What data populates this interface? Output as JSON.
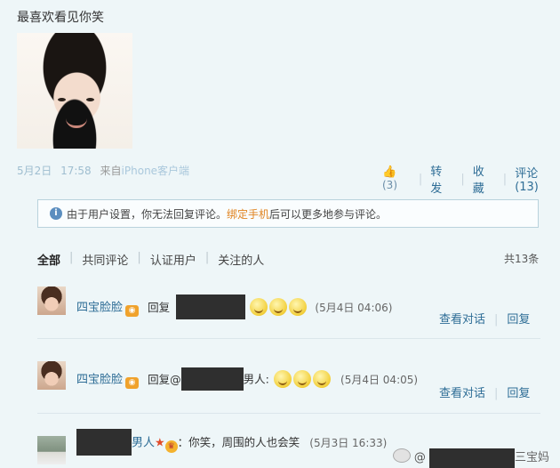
{
  "post": {
    "text": "最喜欢看见你笑",
    "date": "5月2日",
    "time": "17:58",
    "source_prefix": "来自",
    "source": "iPhone客户端"
  },
  "actions": {
    "like_count": "(3)",
    "repost": "转发",
    "favorite": "收藏",
    "comment": "评论(13)"
  },
  "notice": {
    "text_before": "由于用户设置，你无法回复评论。",
    "link": "绑定手机",
    "text_after": "后可以更多地参与评论。"
  },
  "filters": {
    "items": [
      "全部",
      "共同评论",
      "认证用户",
      "关注的人"
    ],
    "total": "共13条"
  },
  "comments": [
    {
      "username": "四宝脸脸",
      "reply_prefix": "回复",
      "time": "(5月4日 04:06)",
      "view_conversation": "查看对话",
      "reply": "回复"
    },
    {
      "username": "四宝脸脸",
      "reply_prefix": "回复@",
      "reply_suffix": "男人:",
      "time": "(5月4日 04:05)",
      "view_conversation": "查看对话",
      "reply": "回复"
    },
    {
      "username_suffix": "男人",
      "text": "：你笑，周围的人也会笑",
      "time": "(5月3日 16:33)"
    }
  ],
  "watermark": {
    "suffix": "三宝妈"
  },
  "icons": {
    "like": "thumbs-up-icon",
    "notice": "info-icon",
    "verified": "photo-badge-icon",
    "emoticon": "smile-emoticon-icon"
  },
  "colors": {
    "background": "#eef6f8",
    "link_blue": "#2e6d96",
    "notice_link": "#e0831f",
    "meta_blue": "#9fbed0"
  }
}
